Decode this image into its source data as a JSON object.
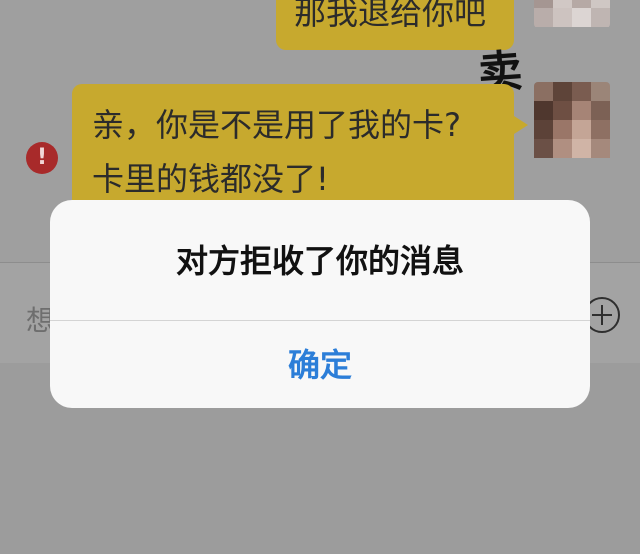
{
  "chat": {
    "messages": [
      {
        "side": "right",
        "text": "那我退给你吧"
      },
      {
        "side": "right",
        "lines": [
          "亲，你是不是用了我的卡?",
          "卡里的钱都没了!"
        ],
        "failed": true
      }
    ],
    "sender_mark": "卖",
    "error_icon_glyph": "!"
  },
  "input": {
    "placeholder": "想",
    "plus_icon": "plus-circle-icon"
  },
  "alert": {
    "message": "对方拒收了你的消息",
    "confirm_label": "确定"
  },
  "colors": {
    "bubble": "#c7a92e",
    "error": "#a82a2a",
    "accent": "#2c7ed8",
    "dialog_bg": "#f8f8f8"
  }
}
